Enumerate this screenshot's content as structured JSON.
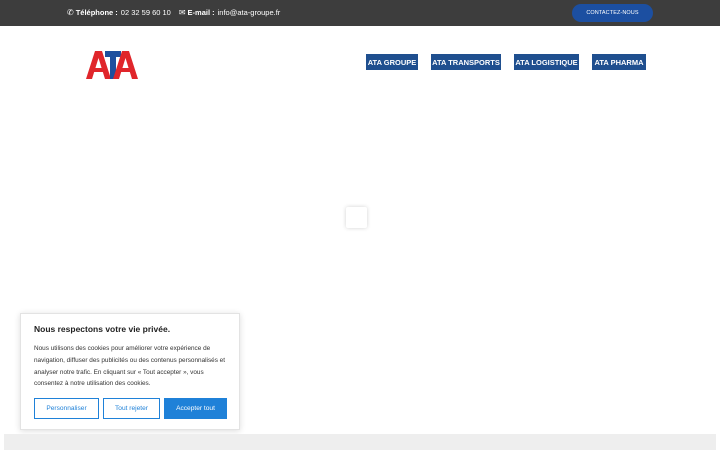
{
  "topbar": {
    "phone_label": "Téléphone :",
    "phone_value": "02 32 59 60 10",
    "email_label": "E-mail :",
    "email_value": "info@ata-groupe.fr",
    "contact_button": "CONTACTEZ-NOUS"
  },
  "header": {
    "logo_text": "ATA",
    "nav": [
      "ATA GROUPE",
      "ATA TRANSPORTS",
      "ATA LOGISTIQUE",
      "ATA PHARMA"
    ]
  },
  "cookie_banner": {
    "title": "Nous respectons votre vie privée.",
    "text": "Nous utilisons des cookies pour améliorer votre expérience de navigation, diffuser des publicités ou des contenus personnalisés et analyser notre trafic. En cliquant sur « Tout accepter », vous consentez à notre utilisation des cookies.",
    "customize_button": "Personnaliser",
    "reject_button": "Tout rejeter",
    "accept_button": "Accepter tout"
  },
  "colors": {
    "topbar_bg": "#3d3d3d",
    "brand_blue": "#1f4f8f",
    "logo_red": "#e0262b",
    "logo_blue": "#1e4f9e",
    "cookie_accent": "#1f81d8"
  }
}
